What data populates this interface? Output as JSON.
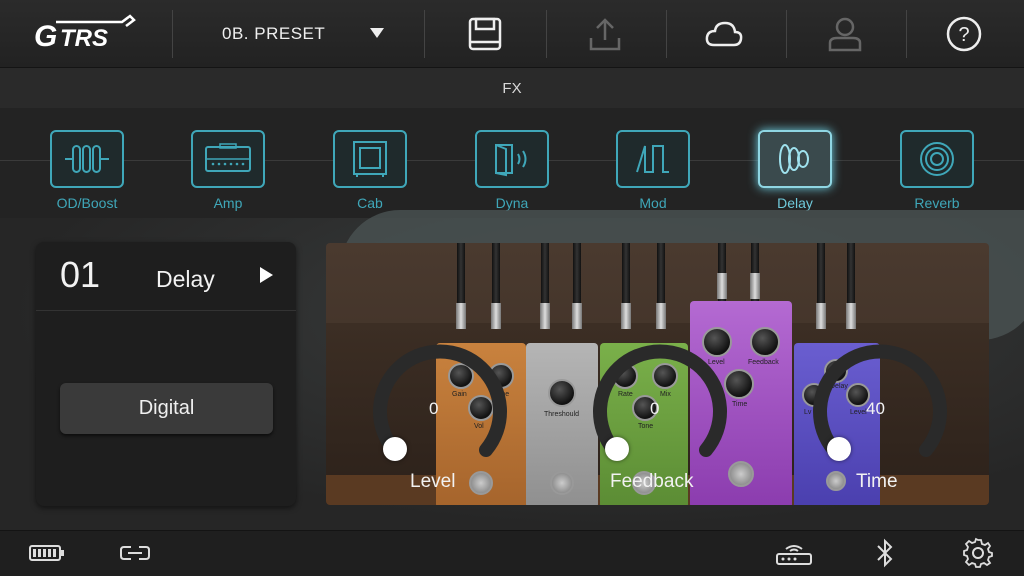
{
  "app": {
    "logo_text": "GTRS"
  },
  "toolbar": {
    "preset_name": "0B. PRESET",
    "icons": [
      "dropdown-arrow-icon",
      "save-icon",
      "upload-icon",
      "cloud-icon",
      "user-icon",
      "help-icon"
    ]
  },
  "fx_section": {
    "title": "FX"
  },
  "effects": [
    {
      "label": "OD/Boost",
      "icon": "od-boost-icon",
      "active": false
    },
    {
      "label": "Amp",
      "icon": "amp-icon",
      "active": false
    },
    {
      "label": "Cab",
      "icon": "cab-icon",
      "active": false
    },
    {
      "label": "Dyna",
      "icon": "dyna-icon",
      "active": false
    },
    {
      "label": "Mod",
      "icon": "mod-icon",
      "active": false
    },
    {
      "label": "Delay",
      "icon": "delay-icon",
      "active": true
    },
    {
      "label": "Reverb",
      "icon": "reverb-icon",
      "active": false
    }
  ],
  "effect_card": {
    "number": "01",
    "name": "Delay",
    "type": "Digital"
  },
  "pedals": {
    "orange": {
      "knob_labels": [
        "Gain",
        "Tone",
        "Vol"
      ]
    },
    "silver": {
      "knob_labels": [
        "Threshould"
      ]
    },
    "green": {
      "knob_labels": [
        "Rate",
        "Mix",
        "Tone"
      ]
    },
    "purple": {
      "knob_labels": [
        "Level",
        "Feedback",
        "Time"
      ]
    },
    "blue": {
      "knob_labels": [
        "Lv",
        "Delay",
        "Level"
      ]
    }
  },
  "controls": [
    {
      "label": "Level",
      "value": "0",
      "level_fraction": 0.0
    },
    {
      "label": "Feedback",
      "value": "0",
      "level_fraction": 0.0
    },
    {
      "label": "Time",
      "value": "40",
      "level_fraction": 0.0
    }
  ],
  "statusbar": {
    "icons": [
      "battery-icon",
      "link-icon",
      "router-icon",
      "bluetooth-icon",
      "settings-icon"
    ]
  },
  "colors": {
    "accent": "#3fa7b9",
    "accent_active": "#8fd6e3"
  }
}
